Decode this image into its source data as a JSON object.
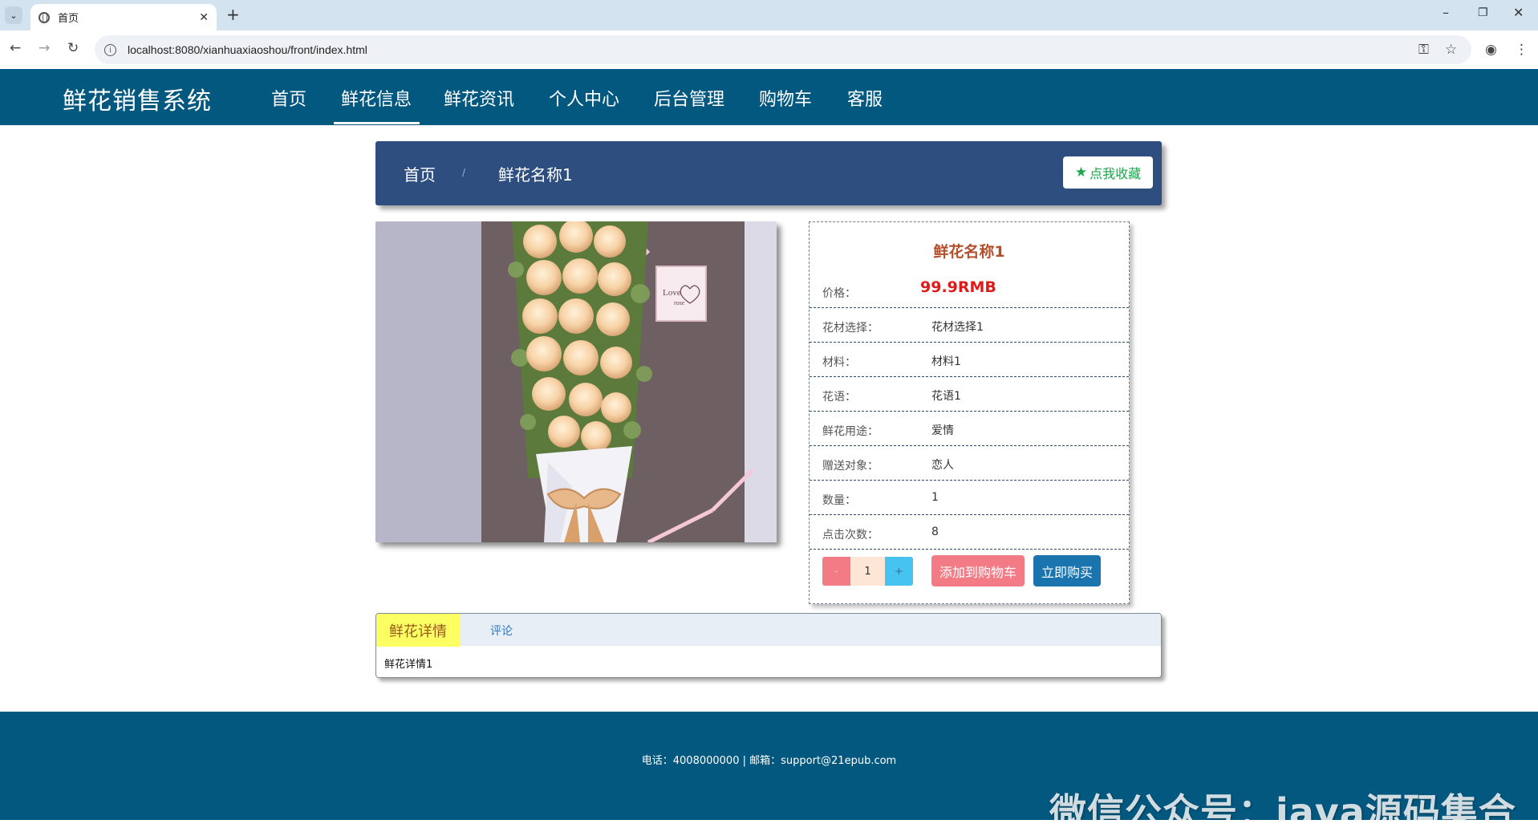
{
  "browser": {
    "tab_title": "首页",
    "tab_close": "✕",
    "new_tab": "+",
    "url": "localhost:8080/xianhuaxiaoshou/front/index.html",
    "window_controls": {
      "minimize": "–",
      "restore": "❐",
      "close": "✕"
    }
  },
  "header": {
    "brand": "鲜花销售系统",
    "nav": [
      "首页",
      "鲜花信息",
      "鲜花资讯",
      "个人中心",
      "后台管理",
      "购物车",
      "客服"
    ],
    "active_nav_index": 1
  },
  "breadcrumb": {
    "home": "首页",
    "separator": "/",
    "current": "鲜花名称1",
    "favorite_icon": "star-icon",
    "favorite_label": "点我收藏"
  },
  "product": {
    "title": "鲜花名称1",
    "price_label": "价格：",
    "price": "99.9RMB",
    "rows": [
      {
        "label": "花材选择：",
        "value": "花材选择1"
      },
      {
        "label": "材料：",
        "value": "材料1"
      },
      {
        "label": "花语：",
        "value": "花语1"
      },
      {
        "label": "鲜花用途：",
        "value": "爱情"
      },
      {
        "label": "赠送对象：",
        "value": "恋人"
      },
      {
        "label": "数量：",
        "value": "1"
      },
      {
        "label": "点击次数：",
        "value": "8"
      }
    ],
    "qty_minus": "-",
    "qty_value": "1",
    "qty_plus": "+",
    "add_to_cart": "添加到购物车",
    "buy_now": "立即购买",
    "photo_card_text_1": "Love",
    "photo_card_text_2": "rose"
  },
  "tabs": {
    "details_label": "鲜花详情",
    "comments_label": "评论",
    "details_content": "鲜花详情1"
  },
  "footer": {
    "contact": "电话：4008000000 | 邮箱：support@21epub.com",
    "watermark": "微信公众号：java源码集合"
  },
  "colors": {
    "header_bg": "#03587f",
    "breadcrumb_bg": "#2d4e7e",
    "price": "#e01b1b",
    "title": "#b34f2a",
    "add_to_cart_bg": "#f27b86",
    "buy_now_bg": "#1a75ae",
    "active_tab_bg": "#fbff62"
  }
}
